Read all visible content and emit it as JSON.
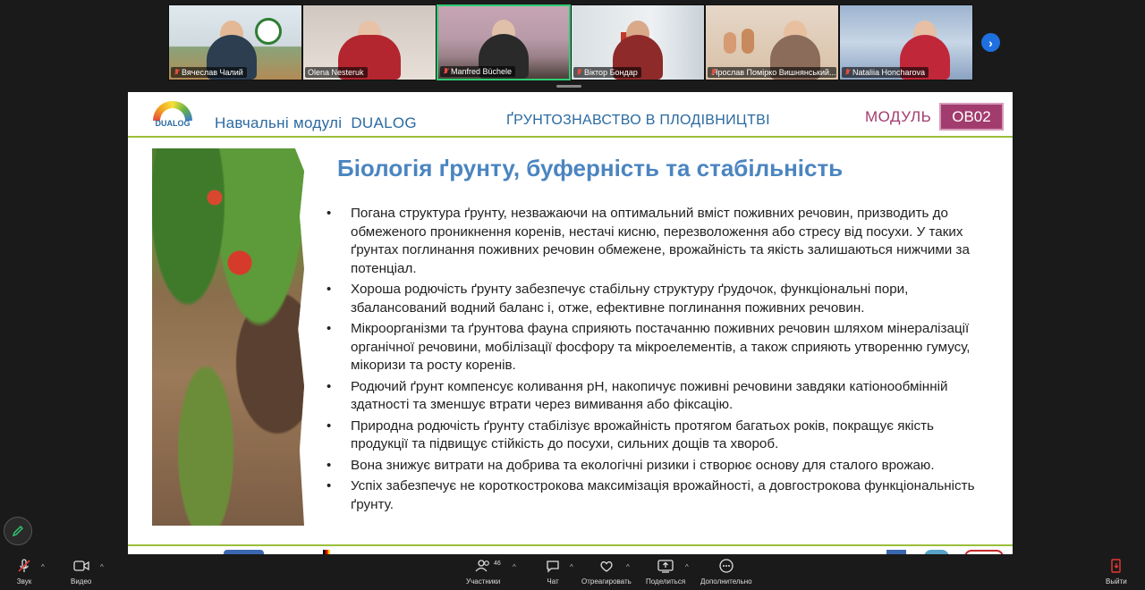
{
  "participants": [
    {
      "name": "Вячеслав Чалий",
      "muted": true
    },
    {
      "name": "Olena Nesteruk",
      "muted": false
    },
    {
      "name": "Manfred Büchele",
      "muted": true,
      "active": true
    },
    {
      "name": "Віктор Бондар",
      "muted": true
    },
    {
      "name": "Ярослав Помірко Вишнянський...",
      "muted": true
    },
    {
      "name": "Nataliia Honcharova",
      "muted": true
    }
  ],
  "slide": {
    "logo_text": "DUALOG",
    "header_left": "Навчальні модулі  DUALOG",
    "header_center": "ҐРУНТОЗНАВСТВО В ПЛОДІВНИЦТВІ",
    "module_label": "МОДУЛЬ",
    "module_code": "OB02",
    "title": "Біологія ґрунту, буферність та стабільність",
    "bullets": [
      "Погана структура ґрунту, незважаючи на оптимальний вміст поживних речовин, призводить до обмеженого проникнення коренів, нестачі кисню, перезволоження або стресу від посухи. У таких ґрунтах поглинання поживних речовин обмежене, врожайність та якість залишаються нижчими за потенціал.",
      "Хороша родючість ґрунту забезпечує стабільну структуру ґрудочок, функціональні пори, збалансований водний баланс і, отже, ефективне поглинання поживних речовин.",
      "Мікроорганізми та ґрунтова фауна сприяють постачанню поживних речовин шляхом мінералізації органічної речовини, мобілізації фосфору та мікроелементів, а також сприяють утворенню гумусу, мікоризи та росту коренів.",
      "Родючий ґрунт компенсує коливання pH, накопичує поживні речовини завдяки катіонообмінній здатності та зменшує втрати через вимивання або фіксацію.",
      "Природна родючість ґрунту стабілізує врожайність протягом багатьох років, покращує якість продукції та підвищує стійкість до посухи, сильних дощів та хвороб.",
      "Вона знижує витрати на добрива та екологічні ризики і створює основу для сталого врожаю.",
      "Успіх забезпечує не короткострокова максимізація врожайності, а довгострокова функціональність ґрунту."
    ]
  },
  "toolbar": {
    "sound": "Звук",
    "video": "Видео",
    "participants": "Участники",
    "participants_count": "46",
    "chat": "Чат",
    "react": "Отреагировать",
    "share": "Поделиться",
    "more": "Дополнительно",
    "leave": "Выйти"
  },
  "colors": {
    "accent": "#2b6aa0",
    "module": "#a23c6e",
    "divider": "#9bbf3a",
    "active_tile": "#2ecc71"
  }
}
